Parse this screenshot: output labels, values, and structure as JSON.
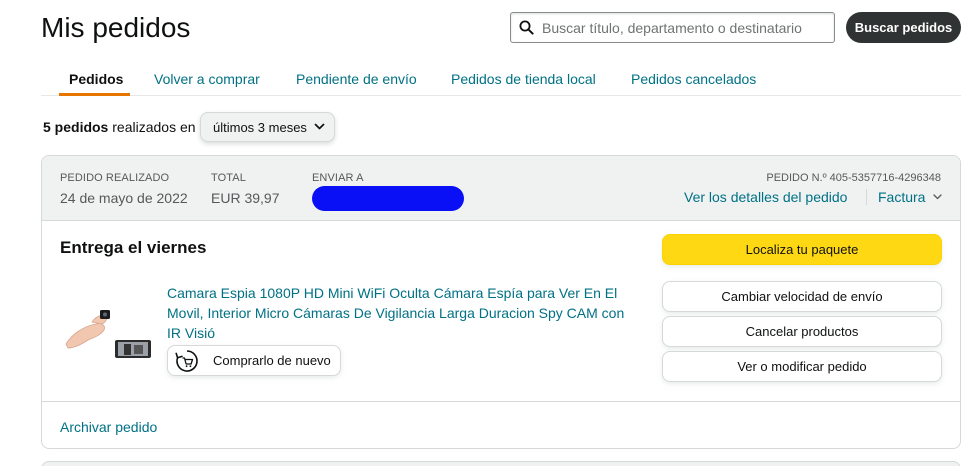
{
  "page": {
    "title": "Mis pedidos"
  },
  "search": {
    "placeholder": "Buscar título, departamento o destinatario",
    "button_label": "Buscar pedidos",
    "icon": "search-icon"
  },
  "tabs": [
    {
      "label": "Pedidos",
      "active": true
    },
    {
      "label": "Volver a comprar",
      "active": false
    },
    {
      "label": "Pendiente de envío",
      "active": false
    },
    {
      "label": "Pedidos de tienda local",
      "active": false
    },
    {
      "label": "Pedidos cancelados",
      "active": false
    }
  ],
  "summary": {
    "count": "5 pedidos",
    "text": "realizados en",
    "period": "últimos 3 meses"
  },
  "order": {
    "placed_label": "PEDIDO REALIZADO",
    "placed_value": "24 de mayo de 2022",
    "total_label": "TOTAL",
    "total_value": "EUR 39,97",
    "ship_to_label": "ENVIAR A",
    "order_number": "PEDIDO N.º 405-5357716-4296348",
    "details_link": "Ver los detalles del pedido",
    "invoice_link": "Factura",
    "delivery_status": "Entrega el viernes",
    "product_title": "Camara Espia 1080P HD Mini WiFi Oculta Cámara Espía para Ver En El Movil, Interior Micro Cámaras De Vigilancia Larga Duracion Spy CAM con IR Visió",
    "buy_again_label": "Comprarlo de nuevo",
    "actions": {
      "track": "Localiza tu paquete",
      "change_speed": "Cambiar velocidad de envío",
      "cancel": "Cancelar productos",
      "modify": "Ver o modificar pedido"
    },
    "archive_link": "Archivar pedido"
  },
  "colors": {
    "link": "#007185",
    "primary_button": "#ffd814",
    "search_button": "#303333",
    "tab_underline": "#e77600",
    "header_bg": "#f0f2f2",
    "redaction": "#0a10f5"
  }
}
